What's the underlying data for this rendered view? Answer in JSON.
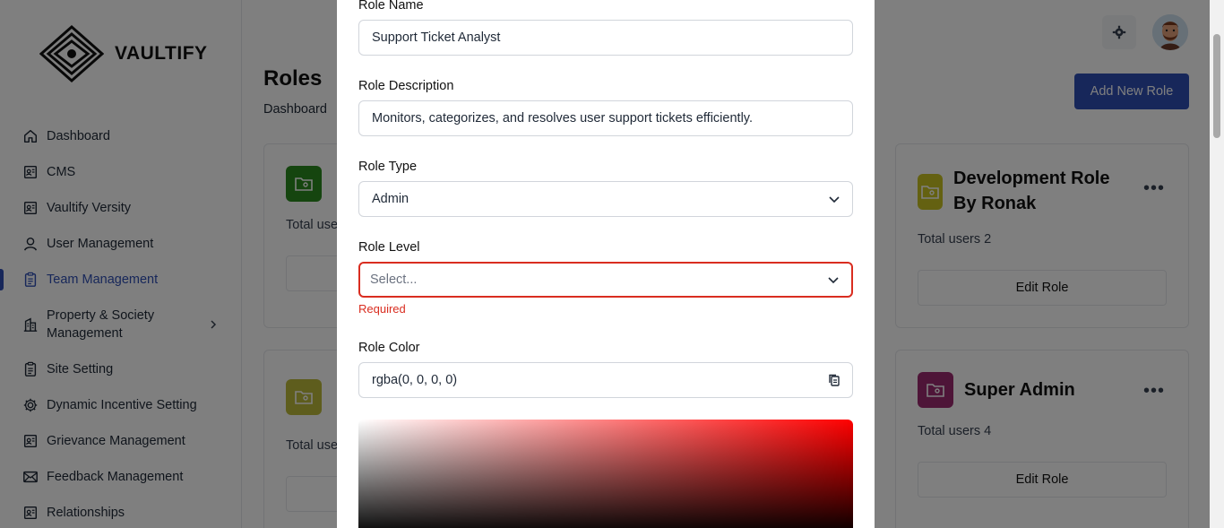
{
  "brand": {
    "name": "VAULTIFY"
  },
  "sidebar": {
    "items": [
      {
        "label": "Dashboard",
        "icon": "home-icon"
      },
      {
        "label": "CMS",
        "icon": "id-card-icon"
      },
      {
        "label": "Vaultify Versity",
        "icon": "id-card-icon"
      },
      {
        "label": "User Management",
        "icon": "user-icon"
      },
      {
        "label": "Team Management",
        "icon": "clipboard-icon",
        "active": true
      },
      {
        "label": "Property & Society Management",
        "icon": "building-icon",
        "has_children": true
      },
      {
        "label": "Site Setting",
        "icon": "clipboard-icon"
      },
      {
        "label": "Dynamic Incentive Setting",
        "icon": "gear-icon"
      },
      {
        "label": "Grievance Management",
        "icon": "id-card-icon"
      },
      {
        "label": "Feedback Management",
        "icon": "mail-icon"
      },
      {
        "label": "Relationships",
        "icon": "id-card-icon"
      }
    ]
  },
  "header": {
    "title": "Roles",
    "breadcrumb": "Dashboard",
    "add_button": "Add New Role"
  },
  "cards": [
    {
      "title": "Development Role By Ronak",
      "users": "Total users 2",
      "button": "Edit Role",
      "color": "#c9c323"
    },
    {
      "title": "Super Admin",
      "users": "Total users 4",
      "button": "Edit Role",
      "color": "#9c2a70"
    },
    {
      "title": "",
      "users": "Total use",
      "color": "#2b8a1e"
    },
    {
      "title": "",
      "users": "Total use",
      "color": "#bdbb3a"
    }
  ],
  "modal": {
    "role_name_label": "Role Name",
    "role_name_value": "Support Ticket Analyst",
    "role_desc_label": "Role Description",
    "role_desc_value": "Monitors, categorizes, and resolves user support tickets efficiently.",
    "role_type_label": "Role Type",
    "role_type_value": "Admin",
    "role_level_label": "Role Level",
    "role_level_placeholder": "Select...",
    "role_level_error": "Required",
    "role_color_label": "Role Color",
    "role_color_value": "rgba(0, 0, 0, 0)"
  },
  "colors": {
    "accent": "#2f4fb5",
    "error": "#d92d20",
    "picker_hue": "#ff0000"
  }
}
